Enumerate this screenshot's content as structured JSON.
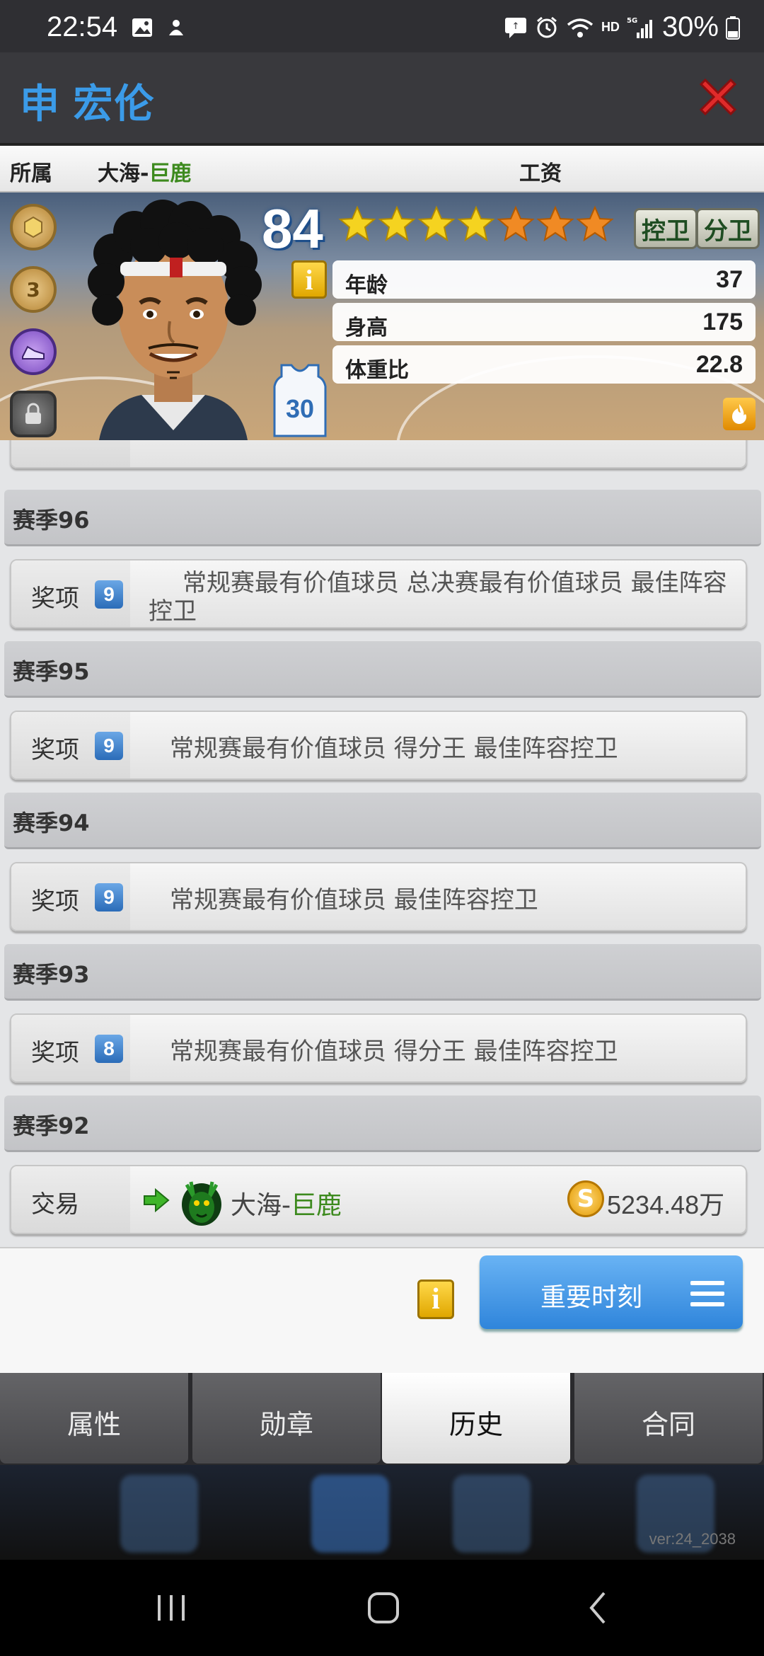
{
  "status_bar": {
    "time": "22:54",
    "battery": "30%",
    "network": "5G",
    "hd": "HD"
  },
  "title_bar": {
    "player_name": "申 宏伦"
  },
  "team_row": {
    "label": "所属",
    "team_prefix": "大海-",
    "team_name": "巨鹿",
    "salary_label": "工资"
  },
  "player_card": {
    "overall": "84",
    "stars_filled": 4,
    "stars_total": 7,
    "positions": [
      "控卫",
      "分卫"
    ],
    "jersey_number": "30",
    "badge_level": "3",
    "info_icon": "i",
    "stats": [
      {
        "label": "年龄",
        "value": "37"
      },
      {
        "label": "身高",
        "value": "175"
      },
      {
        "label": "体重比",
        "value": "22.8"
      }
    ]
  },
  "history": {
    "seasons": [
      {
        "title": "赛季96",
        "entry": {
          "type": "奖项",
          "count": "9",
          "awards": "常规赛最有价值球员  总决赛最有价值球员  最佳阵容控卫"
        }
      },
      {
        "title": "赛季95",
        "entry": {
          "type": "奖项",
          "count": "9",
          "awards": "常规赛最有价值球员  得分王  最佳阵容控卫"
        }
      },
      {
        "title": "赛季94",
        "entry": {
          "type": "奖项",
          "count": "9",
          "awards": "常规赛最有价值球员  最佳阵容控卫"
        }
      },
      {
        "title": "赛季93",
        "entry": {
          "type": "奖项",
          "count": "8",
          "awards": "常规赛最有价值球员  得分王  最佳阵容控卫"
        }
      }
    ],
    "season92": {
      "title": "赛季92",
      "trade": {
        "type": "交易",
        "team_prefix": "大海-",
        "team_name": "巨鹿",
        "coin_symbol": "S",
        "amount": "5234.48万"
      }
    }
  },
  "action_panel": {
    "info_icon": "i",
    "moments_label": "重要时刻"
  },
  "tabs": [
    {
      "label": "属性",
      "active": false
    },
    {
      "label": "勋章",
      "active": false
    },
    {
      "label": "历史",
      "active": true
    },
    {
      "label": "合同",
      "active": false
    }
  ],
  "footer": {
    "version": "ver:24_2038"
  },
  "colors": {
    "accent_blue": "#3b9be8",
    "team_green": "#3d8a1e",
    "star_gold": "#f5d320",
    "star_orange": "#f08a24"
  }
}
